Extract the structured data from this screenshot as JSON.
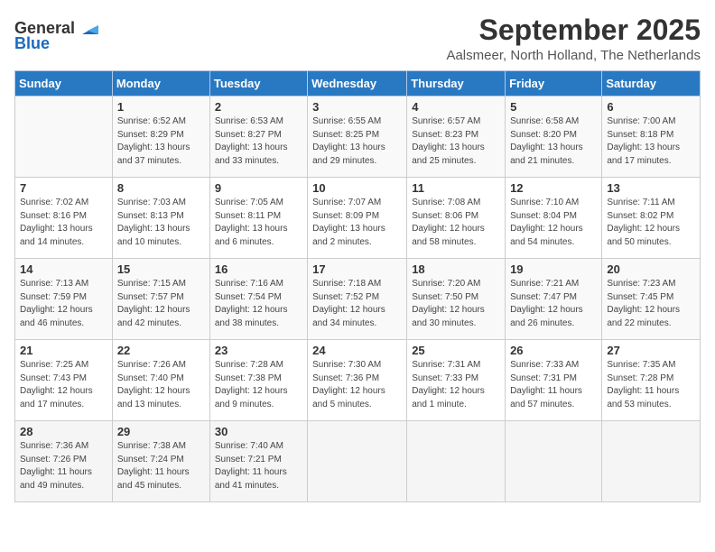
{
  "logo": {
    "general": "General",
    "blue": "Blue"
  },
  "title": "September 2025",
  "location": "Aalsmeer, North Holland, The Netherlands",
  "days_of_week": [
    "Sunday",
    "Monday",
    "Tuesday",
    "Wednesday",
    "Thursday",
    "Friday",
    "Saturday"
  ],
  "weeks": [
    [
      {
        "day": "",
        "sunrise": "",
        "sunset": "",
        "daylight": ""
      },
      {
        "day": "1",
        "sunrise": "Sunrise: 6:52 AM",
        "sunset": "Sunset: 8:29 PM",
        "daylight": "Daylight: 13 hours and 37 minutes."
      },
      {
        "day": "2",
        "sunrise": "Sunrise: 6:53 AM",
        "sunset": "Sunset: 8:27 PM",
        "daylight": "Daylight: 13 hours and 33 minutes."
      },
      {
        "day": "3",
        "sunrise": "Sunrise: 6:55 AM",
        "sunset": "Sunset: 8:25 PM",
        "daylight": "Daylight: 13 hours and 29 minutes."
      },
      {
        "day": "4",
        "sunrise": "Sunrise: 6:57 AM",
        "sunset": "Sunset: 8:23 PM",
        "daylight": "Daylight: 13 hours and 25 minutes."
      },
      {
        "day": "5",
        "sunrise": "Sunrise: 6:58 AM",
        "sunset": "Sunset: 8:20 PM",
        "daylight": "Daylight: 13 hours and 21 minutes."
      },
      {
        "day": "6",
        "sunrise": "Sunrise: 7:00 AM",
        "sunset": "Sunset: 8:18 PM",
        "daylight": "Daylight: 13 hours and 17 minutes."
      }
    ],
    [
      {
        "day": "7",
        "sunrise": "Sunrise: 7:02 AM",
        "sunset": "Sunset: 8:16 PM",
        "daylight": "Daylight: 13 hours and 14 minutes."
      },
      {
        "day": "8",
        "sunrise": "Sunrise: 7:03 AM",
        "sunset": "Sunset: 8:13 PM",
        "daylight": "Daylight: 13 hours and 10 minutes."
      },
      {
        "day": "9",
        "sunrise": "Sunrise: 7:05 AM",
        "sunset": "Sunset: 8:11 PM",
        "daylight": "Daylight: 13 hours and 6 minutes."
      },
      {
        "day": "10",
        "sunrise": "Sunrise: 7:07 AM",
        "sunset": "Sunset: 8:09 PM",
        "daylight": "Daylight: 13 hours and 2 minutes."
      },
      {
        "day": "11",
        "sunrise": "Sunrise: 7:08 AM",
        "sunset": "Sunset: 8:06 PM",
        "daylight": "Daylight: 12 hours and 58 minutes."
      },
      {
        "day": "12",
        "sunrise": "Sunrise: 7:10 AM",
        "sunset": "Sunset: 8:04 PM",
        "daylight": "Daylight: 12 hours and 54 minutes."
      },
      {
        "day": "13",
        "sunrise": "Sunrise: 7:11 AM",
        "sunset": "Sunset: 8:02 PM",
        "daylight": "Daylight: 12 hours and 50 minutes."
      }
    ],
    [
      {
        "day": "14",
        "sunrise": "Sunrise: 7:13 AM",
        "sunset": "Sunset: 7:59 PM",
        "daylight": "Daylight: 12 hours and 46 minutes."
      },
      {
        "day": "15",
        "sunrise": "Sunrise: 7:15 AM",
        "sunset": "Sunset: 7:57 PM",
        "daylight": "Daylight: 12 hours and 42 minutes."
      },
      {
        "day": "16",
        "sunrise": "Sunrise: 7:16 AM",
        "sunset": "Sunset: 7:54 PM",
        "daylight": "Daylight: 12 hours and 38 minutes."
      },
      {
        "day": "17",
        "sunrise": "Sunrise: 7:18 AM",
        "sunset": "Sunset: 7:52 PM",
        "daylight": "Daylight: 12 hours and 34 minutes."
      },
      {
        "day": "18",
        "sunrise": "Sunrise: 7:20 AM",
        "sunset": "Sunset: 7:50 PM",
        "daylight": "Daylight: 12 hours and 30 minutes."
      },
      {
        "day": "19",
        "sunrise": "Sunrise: 7:21 AM",
        "sunset": "Sunset: 7:47 PM",
        "daylight": "Daylight: 12 hours and 26 minutes."
      },
      {
        "day": "20",
        "sunrise": "Sunrise: 7:23 AM",
        "sunset": "Sunset: 7:45 PM",
        "daylight": "Daylight: 12 hours and 22 minutes."
      }
    ],
    [
      {
        "day": "21",
        "sunrise": "Sunrise: 7:25 AM",
        "sunset": "Sunset: 7:43 PM",
        "daylight": "Daylight: 12 hours and 17 minutes."
      },
      {
        "day": "22",
        "sunrise": "Sunrise: 7:26 AM",
        "sunset": "Sunset: 7:40 PM",
        "daylight": "Daylight: 12 hours and 13 minutes."
      },
      {
        "day": "23",
        "sunrise": "Sunrise: 7:28 AM",
        "sunset": "Sunset: 7:38 PM",
        "daylight": "Daylight: 12 hours and 9 minutes."
      },
      {
        "day": "24",
        "sunrise": "Sunrise: 7:30 AM",
        "sunset": "Sunset: 7:36 PM",
        "daylight": "Daylight: 12 hours and 5 minutes."
      },
      {
        "day": "25",
        "sunrise": "Sunrise: 7:31 AM",
        "sunset": "Sunset: 7:33 PM",
        "daylight": "Daylight: 12 hours and 1 minute."
      },
      {
        "day": "26",
        "sunrise": "Sunrise: 7:33 AM",
        "sunset": "Sunset: 7:31 PM",
        "daylight": "Daylight: 11 hours and 57 minutes."
      },
      {
        "day": "27",
        "sunrise": "Sunrise: 7:35 AM",
        "sunset": "Sunset: 7:28 PM",
        "daylight": "Daylight: 11 hours and 53 minutes."
      }
    ],
    [
      {
        "day": "28",
        "sunrise": "Sunrise: 7:36 AM",
        "sunset": "Sunset: 7:26 PM",
        "daylight": "Daylight: 11 hours and 49 minutes."
      },
      {
        "day": "29",
        "sunrise": "Sunrise: 7:38 AM",
        "sunset": "Sunset: 7:24 PM",
        "daylight": "Daylight: 11 hours and 45 minutes."
      },
      {
        "day": "30",
        "sunrise": "Sunrise: 7:40 AM",
        "sunset": "Sunset: 7:21 PM",
        "daylight": "Daylight: 11 hours and 41 minutes."
      },
      {
        "day": "",
        "sunrise": "",
        "sunset": "",
        "daylight": ""
      },
      {
        "day": "",
        "sunrise": "",
        "sunset": "",
        "daylight": ""
      },
      {
        "day": "",
        "sunrise": "",
        "sunset": "",
        "daylight": ""
      },
      {
        "day": "",
        "sunrise": "",
        "sunset": "",
        "daylight": ""
      }
    ]
  ]
}
